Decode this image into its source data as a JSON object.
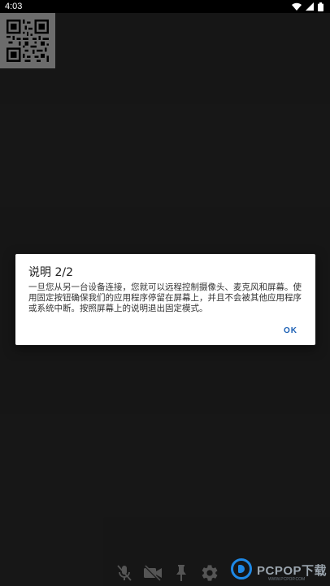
{
  "status_bar": {
    "time": "4:03",
    "icons": [
      "wifi-icon",
      "signal-icon",
      "battery-icon"
    ]
  },
  "qr_code": {
    "icon": "qr-code-icon"
  },
  "dialog": {
    "title": "说明 2/2",
    "message": "一旦您从另一台设备连接，您就可以远程控制摄像头、麦克风和屏幕。使用固定按钮确保我们的应用程序停留在屏幕上，并且不会被其他应用程序或系统中断。按照屏幕上的说明退出固定模式。",
    "ok_label": "OK"
  },
  "toolbar": {
    "items": [
      {
        "name": "mic-off-icon"
      },
      {
        "name": "camera-off-icon"
      },
      {
        "name": "pin-icon"
      },
      {
        "name": "gear-icon"
      }
    ]
  },
  "watermark": {
    "text": "PCPOP下载",
    "subtext": "WWW.PCPOP.COM"
  },
  "colors": {
    "background": "#1a1a1a",
    "dialog_bg": "#ffffff",
    "accent": "#1a5fb4",
    "status_bar": "#000000"
  }
}
